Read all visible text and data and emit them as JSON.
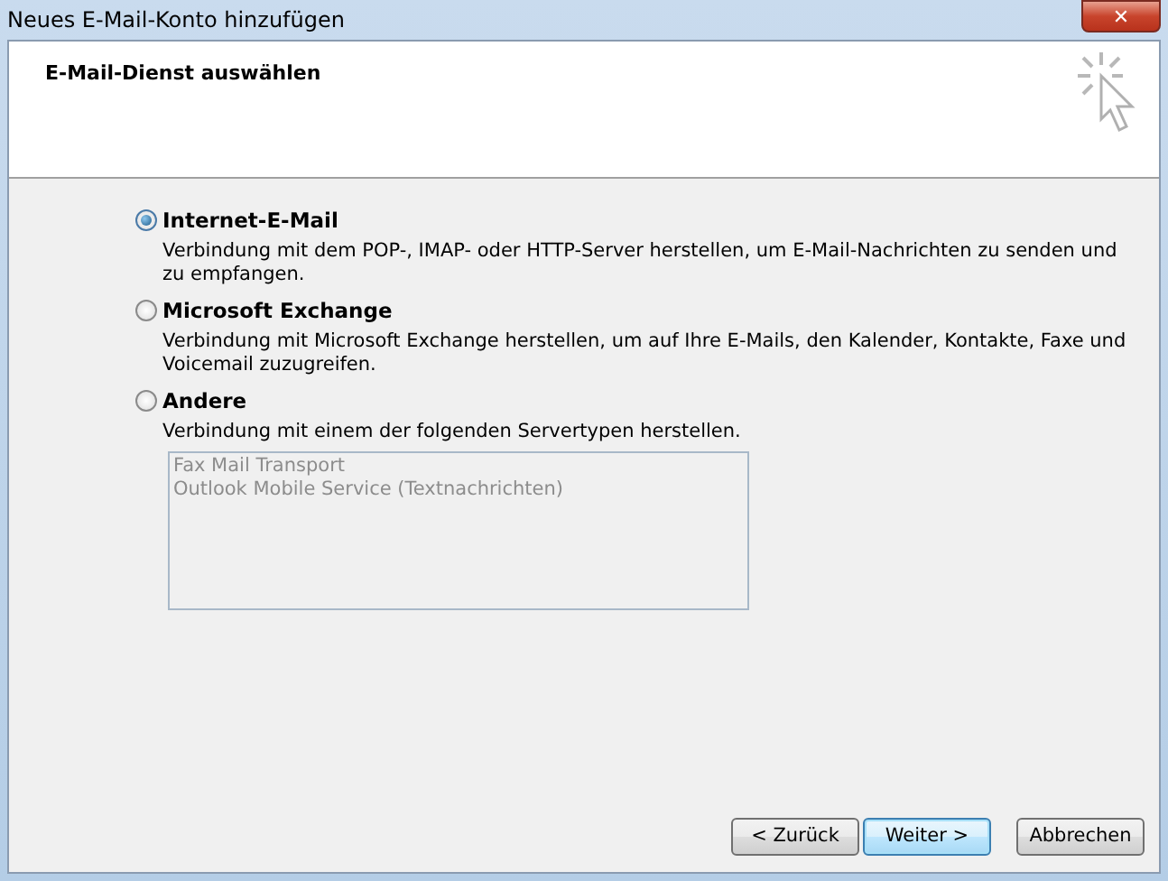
{
  "window": {
    "title": "Neues E-Mail-Konto hinzufügen",
    "close_label": "✕"
  },
  "header": {
    "title": "E-Mail-Dienst auswählen"
  },
  "options": [
    {
      "label": "Internet-E-Mail",
      "description": "Verbindung mit dem POP-, IMAP- oder HTTP-Server herstellen, um E-Mail-Nachrichten zu senden und zu empfangen.",
      "selected": true
    },
    {
      "label": "Microsoft Exchange",
      "description": "Verbindung mit Microsoft Exchange herstellen, um auf Ihre E-Mails, den Kalender, Kontakte, Faxe und Voicemail zuzugreifen.",
      "selected": false
    },
    {
      "label": "Andere",
      "description": "Verbindung mit einem der folgenden Servertypen herstellen.",
      "selected": false,
      "server_types": {
        "disabled": true,
        "items": [
          "Fax Mail Transport",
          "Outlook Mobile Service (Textnachrichten)"
        ]
      }
    }
  ],
  "buttons": [
    {
      "label": "< Zurück",
      "default": false
    },
    {
      "label": "Weiter >",
      "default": true
    },
    {
      "label": "Abbrechen",
      "default": false
    }
  ]
}
